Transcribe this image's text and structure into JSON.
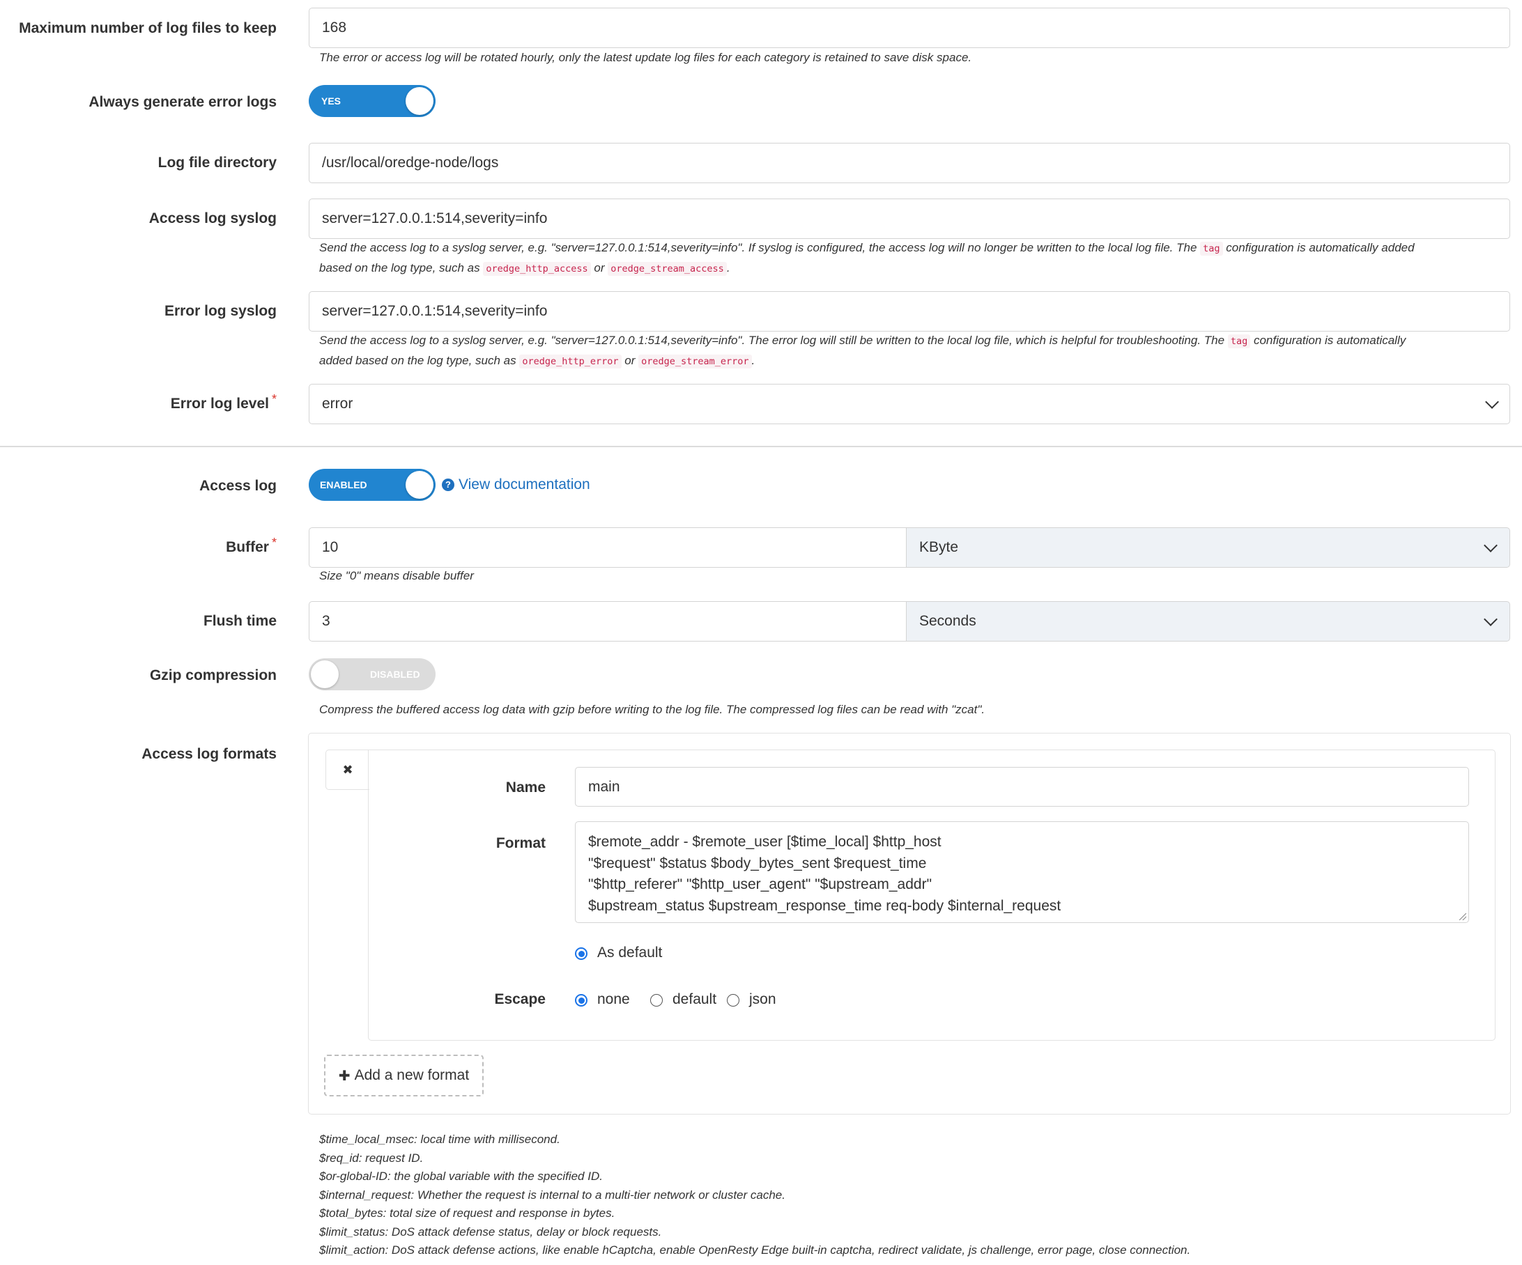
{
  "max_log_files": {
    "label": "Maximum number of log files to keep",
    "value": "168",
    "help": "The error or access log will be rotated hourly, only the latest update log files for each category is retained to save disk space."
  },
  "always_error_logs": {
    "label": "Always generate error logs",
    "toggle_text": "YES",
    "enabled": true
  },
  "log_dir": {
    "label": "Log file directory",
    "value": "/usr/local/oredge-node/logs"
  },
  "access_syslog": {
    "label": "Access log syslog",
    "value": "server=127.0.0.1:514,severity=info",
    "help_part1": "Send the access log to a syslog server, e.g. \"server=127.0.0.1:514,severity=info\". If syslog is configured, the access log will no longer be written to the local log file. The",
    "code_tag": "tag",
    "help_part2": "configuration is automatically added",
    "help_part3": "based on the log type, such as",
    "code1": "oredge_http_access",
    "or": "or",
    "code2": "oredge_stream_access",
    "period": "."
  },
  "error_syslog": {
    "label": "Error log syslog",
    "value": "server=127.0.0.1:514,severity=info",
    "help_part1": "Send the access log to a syslog server, e.g. \"server=127.0.0.1:514,severity=info\". The error log will still be written to the local log file, which is helpful for troubleshooting. The",
    "code_tag": "tag",
    "help_part2": "configuration is automatically",
    "help_part3": "added based on the log type, such as",
    "code1": "oredge_http_error",
    "or": "or",
    "code2": "oredge_stream_error",
    "period": "."
  },
  "error_level": {
    "label": "Error log level",
    "required": "*",
    "value": "error"
  },
  "access_log": {
    "label": "Access log",
    "toggle_text": "ENABLED",
    "enabled": true,
    "doc_link": "View documentation",
    "doc_icon": "question-circle-icon"
  },
  "buffer": {
    "label": "Buffer",
    "required": "*",
    "value": "10",
    "unit": "KByte",
    "help": "Size \"0\" means disable buffer"
  },
  "flush_time": {
    "label": "Flush time",
    "value": "3",
    "unit": "Seconds"
  },
  "gzip": {
    "label": "Gzip compression",
    "toggle_text": "DISABLED",
    "enabled": false,
    "help": "Compress the buffered access log data with gzip before writing to the log file. The compressed log files can be read with \"zcat\"."
  },
  "formats": {
    "label": "Access log formats",
    "remove_icon": "close-icon",
    "remove_glyph": "✖",
    "name_label": "Name",
    "name_value": "main",
    "format_label": "Format",
    "format_lines": [
      "$remote_addr - $remote_user [$time_local] $http_host",
      "\"$request\" $status $body_bytes_sent $request_time",
      "\"$http_referer\" \"$http_user_agent\" \"$upstream_addr\"",
      "$upstream_status $upstream_response_time req-body $internal_request"
    ],
    "as_default_label": "As default",
    "as_default_checked": true,
    "escape_label": "Escape",
    "escape_options": [
      "none",
      "default",
      "json"
    ],
    "escape_selected": "none",
    "add_glyph": "✚",
    "add_label": "Add a new format"
  },
  "variables_help": [
    "$time_local_msec: local time with millisecond.",
    "$req_id: request ID.",
    "$or-global-ID: the global variable with the specified ID.",
    "$internal_request: Whether the request is internal to a multi-tier network or cluster cache.",
    "$total_bytes: total size of request and response in bytes.",
    "$limit_status: DoS attack defense status, delay or block requests.",
    "$limit_action: DoS attack defense actions, like enable hCaptcha, enable OpenResty Edge built-in captcha, redirect validate, js challenge, error page, close connection."
  ],
  "colors": {
    "accent": "#2185d0",
    "link": "#1e70bf",
    "required": "#d9342b",
    "code": "#c7254e"
  }
}
